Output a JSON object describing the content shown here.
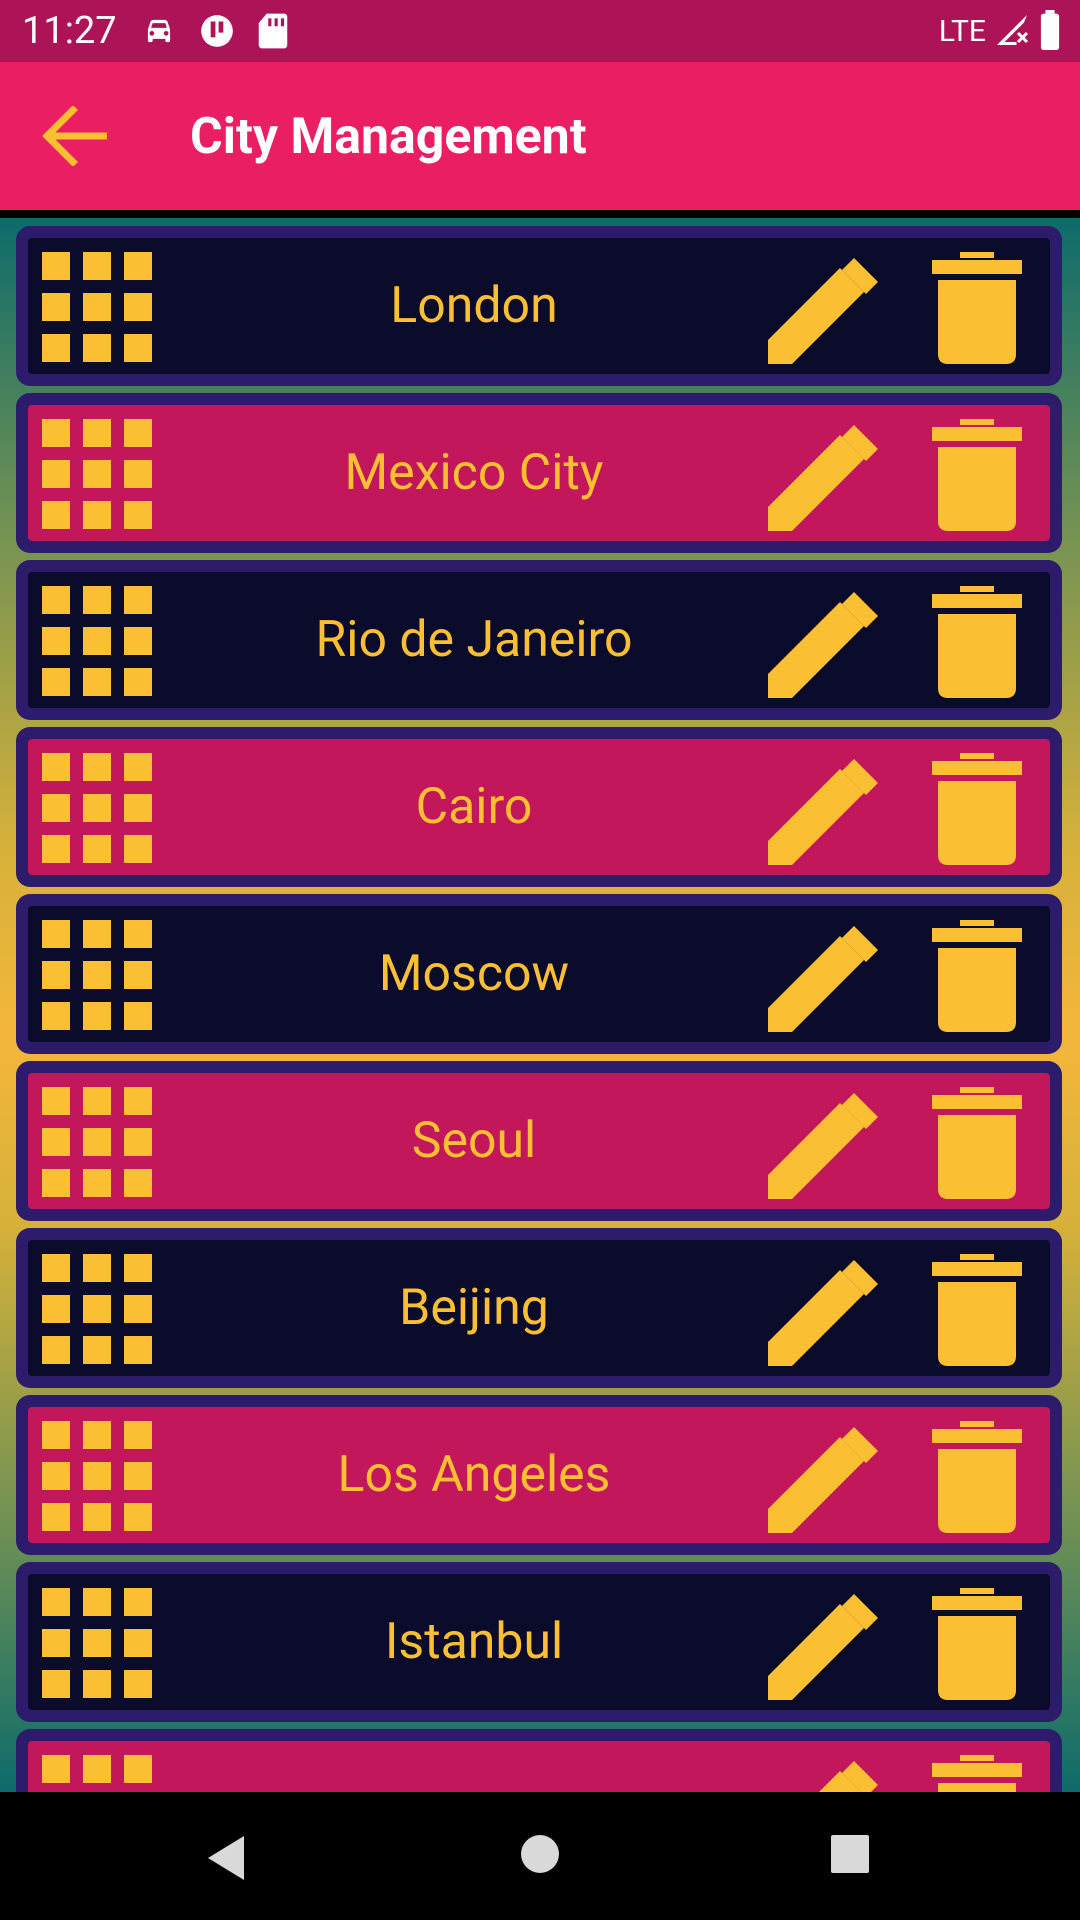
{
  "status_bar": {
    "time": "11:27",
    "network": "LTE",
    "icons": [
      "car-icon",
      "notification-app-icon",
      "sd-card-icon",
      "signal-icon",
      "battery-icon"
    ]
  },
  "app_bar": {
    "title": "City Management",
    "back_icon": "arrow-back-icon"
  },
  "colors": {
    "status_bar": "#AD1457",
    "app_bar": "#E91E63",
    "accent": "#FBBF33",
    "row_dark": "#0B0B2B",
    "row_pink": "#C2185B",
    "row_border": "#2D1B6B"
  },
  "cities": [
    {
      "name": "London",
      "style": "dark"
    },
    {
      "name": "Mexico City",
      "style": "pink"
    },
    {
      "name": "Rio de Janeiro",
      "style": "dark"
    },
    {
      "name": "Cairo",
      "style": "pink"
    },
    {
      "name": "Moscow",
      "style": "dark"
    },
    {
      "name": "Seoul",
      "style": "pink"
    },
    {
      "name": "Beijing",
      "style": "dark"
    },
    {
      "name": "Los Angeles",
      "style": "pink"
    },
    {
      "name": "Istanbul",
      "style": "dark"
    },
    {
      "name": "",
      "style": "pink"
    }
  ],
  "row_icons": {
    "drag": "drag-handle-grid-icon",
    "edit": "pencil-icon",
    "delete": "trash-icon"
  },
  "nav_bar": {
    "back": "nav-back-icon",
    "home": "nav-home-icon",
    "recents": "nav-recents-icon"
  }
}
